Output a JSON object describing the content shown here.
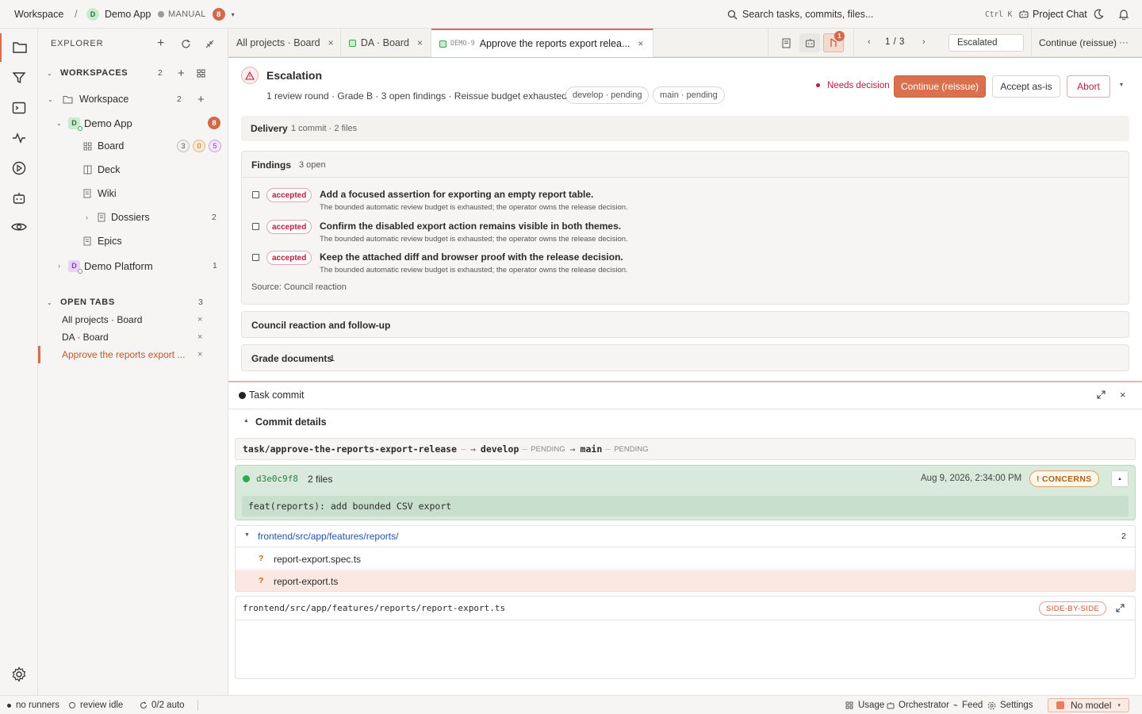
{
  "topbar": {
    "workspace": "Workspace",
    "separator": "/",
    "project_avatar": "D",
    "project_name": "Demo App",
    "mode": "MANUAL",
    "mode_count": "8",
    "search_placeholder": "Search tasks, commits, files...",
    "shortcut": "Ctrl K",
    "project_chat": "Project Chat"
  },
  "explorer": {
    "title": "EXPLORER",
    "workspaces_label": "WORKSPACES",
    "workspaces_count": "2",
    "tree": {
      "workspace": {
        "label": "Workspace",
        "count": "2"
      },
      "demo_app": {
        "avatar": "D",
        "label": "Demo App",
        "count": "8"
      },
      "board": {
        "label": "Board",
        "counts": [
          "3",
          "0",
          "5"
        ]
      },
      "deck": {
        "label": "Deck"
      },
      "wiki": {
        "label": "Wiki"
      },
      "dossiers": {
        "label": "Dossiers",
        "count": "2"
      },
      "epics": {
        "label": "Epics"
      },
      "demo_platform": {
        "avatar": "D",
        "label": "Demo Platform",
        "count": "1"
      }
    },
    "open_tabs_label": "OPEN TABS",
    "open_tabs_count": "3",
    "open_tabs": [
      {
        "label": "All projects · Board"
      },
      {
        "label": "DA · Board"
      },
      {
        "label": "Approve the reports export ..."
      }
    ]
  },
  "tabs": [
    {
      "label": "All projects · Board"
    },
    {
      "label": "DA · Board"
    },
    {
      "prefix": "DEMO-9",
      "label": "Approve the reports export relea..."
    }
  ],
  "toolbar": {
    "alert_count": "1",
    "pager": "1 / 3",
    "status_value": "Escalated",
    "continue_label": "Continue (reissue)",
    "more": "···"
  },
  "escalation": {
    "title": "Escalation",
    "summary": "1 review round · Grade B · 3 open findings · Reissue budget exhausted",
    "chips": [
      "develop · pending",
      "main · pending"
    ],
    "needs_decision": "Needs decision",
    "continue_btn": "Continue (reissue)",
    "accept_btn": "Accept as-is",
    "abort_btn": "Abort"
  },
  "delivery": {
    "title": "Delivery",
    "meta": "1 commit · 2 files"
  },
  "findings": {
    "title": "Findings",
    "meta": "3 open",
    "items": [
      {
        "tag": "accepted",
        "title": "Add a focused assertion for exporting an empty report table.",
        "note": "The bounded automatic review budget is exhausted; the operator owns the release decision."
      },
      {
        "tag": "accepted",
        "title": "Confirm the disabled export action remains visible in both themes.",
        "note": "The bounded automatic review budget is exhausted; the operator owns the release decision."
      },
      {
        "tag": "accepted",
        "title": "Keep the attached diff and browser proof with the release decision.",
        "note": "The bounded automatic review budget is exhausted; the operator owns the release decision."
      }
    ],
    "source": "Source: Council reaction"
  },
  "council": {
    "title": "Council reaction and follow-up"
  },
  "grade_docs": {
    "title": "Grade documents",
    "count": "1"
  },
  "panel": {
    "title": "Task commit",
    "commit_details": "Commit details",
    "branch": "task/approve-the-reports-export-release",
    "develop": "develop",
    "main": "main",
    "pending": "PENDING",
    "hash": "d3e0c9f8",
    "files_count": "2 files",
    "date": "Aug 9, 2026, 2:34:00 PM",
    "concerns": "! CONCERNS",
    "message": "feat(reports): add bounded CSV export",
    "folder": "frontend/src/app/features/reports/",
    "folder_count": "2",
    "files": [
      "report-export.spec.ts",
      "report-export.ts"
    ],
    "file_status": "?",
    "diff_path": "frontend/src/app/features/reports/report-export.ts",
    "diff_mode": "SIDE-BY-SIDE"
  },
  "statusbar": {
    "runners": "no runners",
    "review": "review idle",
    "auto": "0/2 auto",
    "usage": "Usage",
    "orchestrator": "Orchestrator",
    "feed": "Feed",
    "settings": "Settings",
    "model": "No model"
  },
  "colors": {
    "accent": "#d96d4e",
    "danger": "#b4203f",
    "success": "#2fa84f",
    "project_green": "#c9ebce",
    "project_purple": "#b06ad8"
  }
}
